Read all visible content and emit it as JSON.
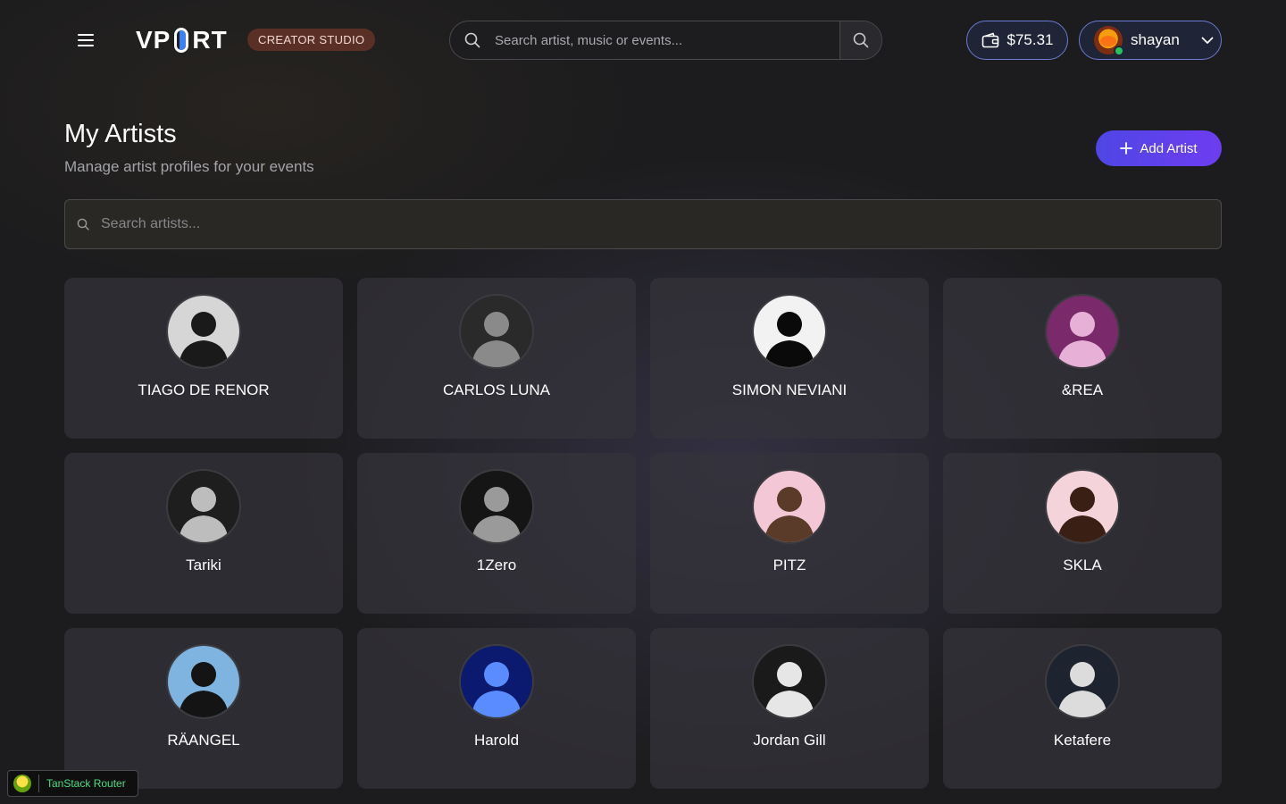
{
  "header": {
    "logo_text_left": "VP",
    "logo_text_right": "RT",
    "studio_badge": "CREATOR STUDIO",
    "search_placeholder": "Search artist, music or events...",
    "wallet_balance": "$75.31",
    "username": "shayan"
  },
  "page": {
    "title": "My Artists",
    "subtitle": "Manage artist profiles for your events",
    "add_button_label": "Add Artist",
    "artist_search_placeholder": "Search artists..."
  },
  "artists": [
    {
      "name": "TIAGO DE RENOR",
      "photo": {
        "bg": "#d6d6d6",
        "fg": "#1a1a1a"
      }
    },
    {
      "name": "CARLOS LUNA",
      "photo": {
        "bg": "#2a2a2a",
        "fg": "#8a8a8a"
      }
    },
    {
      "name": "SIMON NEVIANI",
      "photo": {
        "bg": "#f2f2f2",
        "fg": "#0a0a0a"
      }
    },
    {
      "name": "&REA",
      "photo": {
        "bg": "#7a2a6a",
        "fg": "#e7b0d6"
      }
    },
    {
      "name": "Tariki",
      "photo": {
        "bg": "#1e1e1e",
        "fg": "#bdbdbd"
      }
    },
    {
      "name": "1Zero",
      "photo": {
        "bg": "#151515",
        "fg": "#9a9a9a"
      }
    },
    {
      "name": "PITZ",
      "photo": {
        "bg": "#f4c7d6",
        "fg": "#5a3a28"
      }
    },
    {
      "name": "SKLA",
      "photo": {
        "bg": "#f5d3da",
        "fg": "#3a1f14"
      }
    },
    {
      "name": "RÄANGEL",
      "photo": {
        "bg": "#7fb3e0",
        "fg": "#141414"
      }
    },
    {
      "name": "Harold",
      "photo": {
        "bg": "#0b1a6e",
        "fg": "#5a8cff"
      }
    },
    {
      "name": "Jordan Gill",
      "photo": {
        "bg": "#1a1a1a",
        "fg": "#e6e6e6"
      }
    },
    {
      "name": "Ketafere",
      "photo": {
        "bg": "#1d2430",
        "fg": "#dcdcdc"
      }
    }
  ],
  "devtools": {
    "label": "TanStack Router"
  },
  "colors": {
    "accent": "#4f46e5",
    "studio_badge_bg": "#5a2f25",
    "online": "#22c55e"
  }
}
